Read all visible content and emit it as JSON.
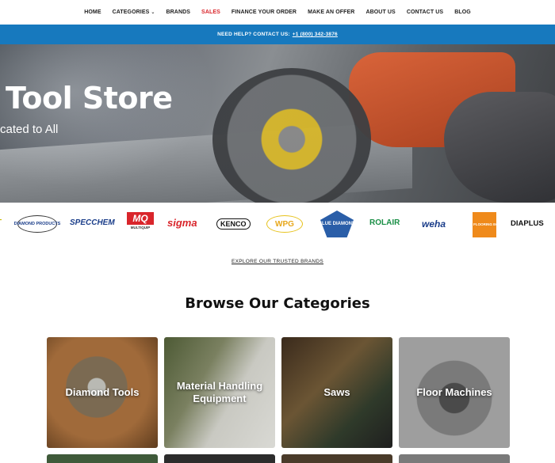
{
  "nav": {
    "items": [
      {
        "label": "HOME"
      },
      {
        "label": "CATEGORIES"
      },
      {
        "label": "BRANDS"
      },
      {
        "label": "SALES"
      },
      {
        "label": "FINANCE YOUR ORDER"
      },
      {
        "label": "MAKE AN OFFER"
      },
      {
        "label": "ABOUT US"
      },
      {
        "label": "CONTACT US"
      },
      {
        "label": "BLOG"
      }
    ],
    "categories_chevron": "⌄",
    "accent_color": "#d9252b"
  },
  "helpbar": {
    "text": "NEED HELP? CONTACT US:",
    "phone": "+1 (800) 342-3876",
    "background": "#1779be"
  },
  "hero": {
    "title": "Tool Store",
    "subtitle": "cated to All"
  },
  "brands": {
    "logos": [
      {
        "name": "T",
        "icon": "partial-brand-logo"
      },
      {
        "name": "DIAMOND PRODUCTS"
      },
      {
        "name": "SPECCHEM"
      },
      {
        "name": "MQ",
        "sub": "MULTIQUIP"
      },
      {
        "name": "sigma"
      },
      {
        "name": "KENCO"
      },
      {
        "name": "WPG"
      },
      {
        "name": "BLUE DIAMOND"
      },
      {
        "name": "ROLAIR"
      },
      {
        "name": "weha"
      },
      {
        "name": "NATIONAL FLOORING EQUIPMENT"
      },
      {
        "name": "DIAPLUS"
      }
    ],
    "explore_link": "EXPLORE OUR TRUSTED BRANDS"
  },
  "categories": {
    "title": "Browse Our Categories",
    "cards": [
      {
        "label": "Diamond Tools"
      },
      {
        "label": "Material Handling Equipment"
      },
      {
        "label": "Saws"
      },
      {
        "label": "Floor Machines"
      }
    ]
  }
}
